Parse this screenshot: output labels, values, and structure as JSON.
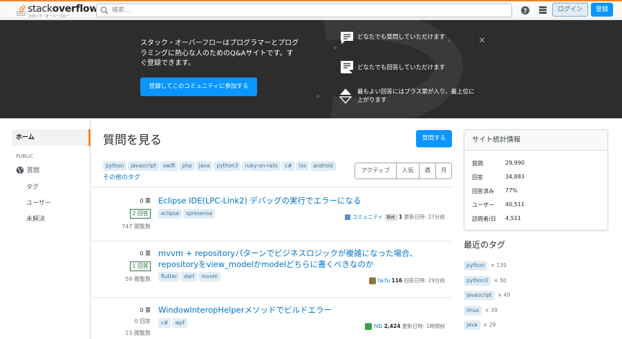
{
  "header": {
    "logo_text_light": "stack",
    "logo_text_bold": "overflow",
    "logo_subtext": "スタック・オーバーフロー",
    "search_placeholder": "検索...",
    "login_label": "ログイン",
    "signup_label": "登録",
    "icons": [
      "search-icon",
      "help-icon",
      "site-switcher-icon"
    ]
  },
  "hero": {
    "intro_text": "スタック・オーバーフローはプログラマーとプログラミングに熱心な人のためのQ&Aサイトです。すぐ登録できます。",
    "join_label": "登録してこのコミュニティに参加する",
    "features": [
      {
        "icon": "question-bubble-icon",
        "text": "どなたでも質問していただけます"
      },
      {
        "icon": "answer-bubble-icon",
        "text": "どなたでも回答していただけます"
      },
      {
        "icon": "vote-arrows-icon",
        "text": "最もよい回答にはプラス票が入り、最上位に上がります"
      }
    ],
    "close_symbol": "×"
  },
  "leftnav": {
    "home": "ホーム",
    "public": "PUBLIC",
    "questions": "質問",
    "tags": "タグ",
    "users": "ユーザー",
    "unanswered": "未解決"
  },
  "main": {
    "title": "質問を見る",
    "ask_label": "質問する",
    "tags": [
      "python",
      "javascript",
      "swift",
      "php",
      "java",
      "python3",
      "ruby-on-rails",
      "c#",
      "ios",
      "android"
    ],
    "more_tags": "その他のタグ",
    "filters": [
      "アクティブ",
      "人気",
      "週",
      "月"
    ],
    "questions": [
      {
        "votes": "0 票",
        "answers": "2 回答",
        "views": "747 閲覧数",
        "title": "Eclipse IDE(LPC-Link2) デバッグの実行でエラーになる",
        "tags": [
          "eclipse",
          "spresense"
        ],
        "user": "コミュニティ",
        "badge": "Bot",
        "rep": "1",
        "time": "更新日時: 27分前"
      },
      {
        "votes": "0 票",
        "answers": "1 回答",
        "views": "59 閲覧数",
        "title": "mvvm + repositoryパターンでビジネスロジックが複雑になった場合、repositoryをview_modelかmodelどちらに書くべきなのか",
        "tags": [
          "flutter",
          "dart",
          "mvvm"
        ],
        "user": "ta.fu",
        "rep": "116",
        "time": "回答日時: 29分前"
      },
      {
        "votes": "0 票",
        "answers": "0 回答",
        "views": "13 閲覧数",
        "title": "WindowInteropHelperメソッドでビルドエラー",
        "tags": [
          "c#",
          "wpf"
        ],
        "user": "htb",
        "rep": "2,424",
        "time": "更新日時: 1時間前"
      }
    ]
  },
  "sidebar": {
    "stats_title": "サイト統計情報",
    "stats": [
      {
        "label": "質問",
        "value": "29,990"
      },
      {
        "label": "回答",
        "value": "34,883"
      },
      {
        "label": "回答済み",
        "value": "77%"
      },
      {
        "label": "ユーザー",
        "value": "40,511"
      },
      {
        "label": "訪問者/日",
        "value": "4,511"
      }
    ],
    "recent_tags_title": "最近のタグ",
    "recent_tags": [
      {
        "name": "python",
        "count": "× 139"
      },
      {
        "name": "python3",
        "count": "× 50"
      },
      {
        "name": "javascript",
        "count": "× 49"
      },
      {
        "name": "linux",
        "count": "× 39"
      },
      {
        "name": "java",
        "count": "× 29"
      }
    ]
  },
  "colors": {
    "accent": "#f48225",
    "primary": "#0a95ff",
    "link": "#0074cc",
    "tag_bg": "#e1ecf4",
    "tag_fg": "#39739d",
    "hero_bg": "#2d2d2d"
  }
}
